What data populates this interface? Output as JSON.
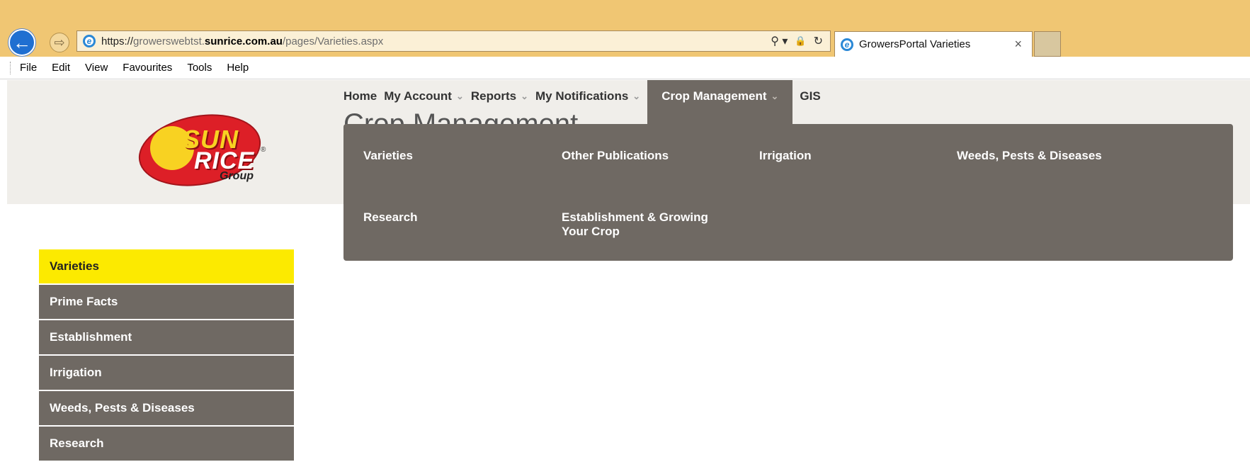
{
  "browser": {
    "url_prefix": "https://",
    "url_subdomain": "growerswebtst.",
    "url_domain": "sunrice.com.au",
    "url_path": "/pages/Varieties.aspx",
    "tab_title": "GrowersPortal Varieties",
    "tab_close": "×",
    "back_glyph": "←",
    "forward_glyph": "⇨",
    "search_glyph": "⚲ ▾",
    "lock_glyph": "🔒",
    "refresh_glyph": "↻",
    "ie_glyph": "e"
  },
  "menubar": {
    "items": [
      "File",
      "Edit",
      "View",
      "Favourites",
      "Tools",
      "Help"
    ]
  },
  "logo": {
    "word1": "SUN",
    "word2": "RICE",
    "group": "Group",
    "reg": "®"
  },
  "topnav": {
    "items": [
      {
        "label": "Home",
        "chevron": ""
      },
      {
        "label": "My Account",
        "chevron": "⌄"
      },
      {
        "label": "Reports",
        "chevron": "⌄"
      },
      {
        "label": "My Notifications",
        "chevron": "⌄"
      },
      {
        "label": "Crop Management",
        "chevron": "⌄"
      },
      {
        "label": "GIS",
        "chevron": ""
      }
    ]
  },
  "page_heading": "Crop Management",
  "dropdown": {
    "items": [
      "Varieties",
      "Other Publications",
      "Irrigation",
      "Weeds, Pests & Diseases",
      "Research",
      "Establishment & Growing Your Crop"
    ]
  },
  "sidenav": {
    "items": [
      "Varieties",
      "Prime Facts",
      "Establishment",
      "Irrigation",
      "Weeds, Pests & Diseases",
      "Research"
    ]
  },
  "colors": {
    "chrome": "#f0c673",
    "nav_dark": "#6f6963",
    "active_yellow": "#fcea00",
    "logo_red": "#dd1f27"
  }
}
